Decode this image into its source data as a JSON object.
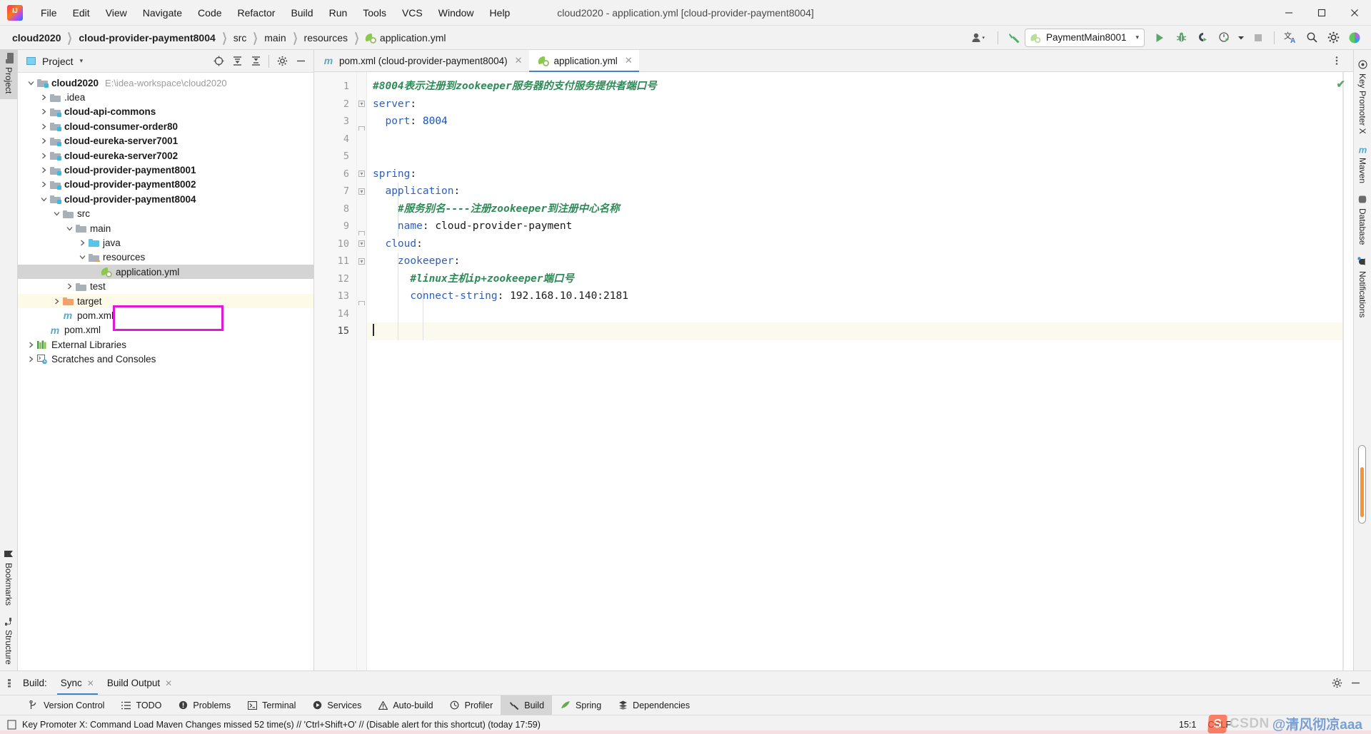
{
  "window": {
    "title": "cloud2020 - application.yml [cloud-provider-payment8004]",
    "logo_label": "IJ",
    "minimize": "─",
    "maximize": "❐",
    "close": "✕"
  },
  "menubar": [
    {
      "label": "File"
    },
    {
      "label": "Edit"
    },
    {
      "label": "View"
    },
    {
      "label": "Navigate"
    },
    {
      "label": "Code"
    },
    {
      "label": "Refactor"
    },
    {
      "label": "Build"
    },
    {
      "label": "Run"
    },
    {
      "label": "Tools"
    },
    {
      "label": "VCS"
    },
    {
      "label": "Window"
    },
    {
      "label": "Help"
    }
  ],
  "breadcrumbs": [
    {
      "label": "cloud2020",
      "bold": true
    },
    {
      "label": "cloud-provider-payment8004",
      "bold": true
    },
    {
      "label": "src",
      "bold": false
    },
    {
      "label": "main",
      "bold": false
    },
    {
      "label": "resources",
      "bold": false
    },
    {
      "label": "application.yml",
      "bold": false,
      "icon": "spring-yml-icon"
    }
  ],
  "navbar_right": {
    "account_icon": "user-avatar-icon",
    "hammer_icon": "build-hammer-icon",
    "run_config": {
      "name": "PaymentMain8001",
      "icon": "spring-boot-icon",
      "caret": "▾"
    },
    "run_icon": "run-icon",
    "debug_icon": "debug-bug-icon",
    "coverage_icon": "run-with-coverage-icon",
    "profiler_icon": "profile-icon",
    "stop_icon": "stop-icon",
    "translate_icon": "translate-icon",
    "search_icon": "search-everywhere-icon",
    "settings_icon": "gear-icon",
    "updates_icon": "ide-updates-icon"
  },
  "left_strip": [
    {
      "label": "Project",
      "icon": "project-folder-icon",
      "active": true
    },
    {
      "label": "Bookmarks",
      "icon": "bookmark-icon",
      "active": false
    },
    {
      "label": "Structure",
      "icon": "structure-icon",
      "active": false
    }
  ],
  "right_strip": [
    {
      "label": "Key Promoter X",
      "icon": "key-promoter-icon"
    },
    {
      "label": "Maven",
      "icon": "maven-m-icon"
    },
    {
      "label": "Database",
      "icon": "database-icon"
    },
    {
      "label": "Notifications",
      "icon": "notifications-bell-icon"
    }
  ],
  "project_panel": {
    "title": "Project",
    "caret": "▾",
    "actions": [
      {
        "name": "select-opened-file-icon",
        "glyph": "⊕"
      },
      {
        "name": "expand-all-icon",
        "glyph": "⤓"
      },
      {
        "name": "collapse-all-icon",
        "glyph": "⤑"
      },
      {
        "name": "gear-icon",
        "glyph": "⚙"
      },
      {
        "name": "hide-icon",
        "glyph": "─"
      }
    ],
    "tree": [
      {
        "label": "cloud2020",
        "path": "E:\\idea-workspace\\cloud2020",
        "indent": 0,
        "arrow": "down",
        "icon": "module-folder-icon",
        "bold": true
      },
      {
        "label": ".idea",
        "indent": 1,
        "arrow": "right",
        "icon": "folder-icon",
        "bold": false
      },
      {
        "label": "cloud-api-commons",
        "indent": 1,
        "arrow": "right",
        "icon": "module-folder-icon",
        "bold": true
      },
      {
        "label": "cloud-consumer-order80",
        "indent": 1,
        "arrow": "right",
        "icon": "module-folder-icon",
        "bold": true
      },
      {
        "label": "cloud-eureka-server7001",
        "indent": 1,
        "arrow": "right",
        "icon": "module-folder-icon",
        "bold": true
      },
      {
        "label": "cloud-eureka-server7002",
        "indent": 1,
        "arrow": "right",
        "icon": "module-folder-icon",
        "bold": true
      },
      {
        "label": "cloud-provider-payment8001",
        "indent": 1,
        "arrow": "right",
        "icon": "module-folder-icon",
        "bold": true
      },
      {
        "label": "cloud-provider-payment8002",
        "indent": 1,
        "arrow": "right",
        "icon": "module-folder-icon",
        "bold": true
      },
      {
        "label": "cloud-provider-payment8004",
        "indent": 1,
        "arrow": "down",
        "icon": "module-folder-icon",
        "bold": true
      },
      {
        "label": "src",
        "indent": 2,
        "arrow": "down",
        "icon": "folder-icon",
        "bold": false
      },
      {
        "label": "main",
        "indent": 3,
        "arrow": "down",
        "icon": "folder-icon",
        "bold": false
      },
      {
        "label": "java",
        "indent": 4,
        "arrow": "right",
        "icon": "source-folder-icon",
        "bold": false
      },
      {
        "label": "resources",
        "indent": 4,
        "arrow": "down",
        "icon": "resources-folder-icon",
        "bold": false
      },
      {
        "label": "application.yml",
        "indent": 5,
        "arrow": "none",
        "icon": "spring-yml-icon",
        "bold": false,
        "selected": true,
        "highlighted": true
      },
      {
        "label": "test",
        "indent": 3,
        "arrow": "right",
        "icon": "folder-icon",
        "bold": false
      },
      {
        "label": "target",
        "indent": 2,
        "arrow": "right",
        "icon": "target-folder-icon",
        "bold": false,
        "modified": true
      },
      {
        "label": "pom.xml",
        "indent": 2,
        "arrow": "none",
        "icon": "maven-m-icon",
        "bold": false
      },
      {
        "label": "pom.xml",
        "indent": 1,
        "arrow": "none",
        "icon": "maven-m-icon",
        "bold": false
      },
      {
        "label": "External Libraries",
        "indent": 0,
        "arrow": "right",
        "icon": "external-libraries-icon",
        "bold": false
      },
      {
        "label": "Scratches and Consoles",
        "indent": 0,
        "arrow": "right",
        "icon": "scratches-icon",
        "bold": false
      }
    ]
  },
  "editor": {
    "tabs": [
      {
        "label": "pom.xml (cloud-provider-payment8004)",
        "icon": "maven-m-icon",
        "active": false,
        "close": "✕"
      },
      {
        "label": "application.yml",
        "icon": "spring-yml-icon",
        "active": true,
        "close": "✕"
      }
    ],
    "inspection_status": "✔",
    "lines": [
      {
        "n": 1,
        "segs": [
          {
            "t": "#8004表示注册到zookeeper服务器的支付服务提供者端口号",
            "c": "cmt"
          }
        ],
        "indent": 0,
        "fold": "none"
      },
      {
        "n": 2,
        "segs": [
          {
            "t": "server",
            "c": "kw"
          },
          {
            "t": ":",
            "c": "val"
          }
        ],
        "indent": 0,
        "fold": "open"
      },
      {
        "n": 3,
        "segs": [
          {
            "t": "  port",
            "c": "kw"
          },
          {
            "t": ": ",
            "c": "val"
          },
          {
            "t": "8004",
            "c": "num"
          }
        ],
        "indent": 1,
        "fold": "end"
      },
      {
        "n": 4,
        "segs": [],
        "indent": 0,
        "fold": "none"
      },
      {
        "n": 5,
        "segs": [],
        "indent": 0,
        "fold": "none"
      },
      {
        "n": 6,
        "segs": [
          {
            "t": "spring",
            "c": "kw"
          },
          {
            "t": ":",
            "c": "val"
          }
        ],
        "indent": 0,
        "fold": "open"
      },
      {
        "n": 7,
        "segs": [
          {
            "t": "  application",
            "c": "kw"
          },
          {
            "t": ":",
            "c": "val"
          }
        ],
        "indent": 1,
        "fold": "open"
      },
      {
        "n": 8,
        "segs": [
          {
            "t": "    #服务别名----注册zookeeper到注册中心名称",
            "c": "cmt"
          }
        ],
        "indent": 2,
        "fold": "none"
      },
      {
        "n": 9,
        "segs": [
          {
            "t": "    name",
            "c": "kw"
          },
          {
            "t": ": ",
            "c": "val"
          },
          {
            "t": "cloud-provider-payment",
            "c": "val"
          }
        ],
        "indent": 2,
        "fold": "end"
      },
      {
        "n": 10,
        "segs": [
          {
            "t": "  cloud",
            "c": "kw"
          },
          {
            "t": ":",
            "c": "val"
          }
        ],
        "indent": 1,
        "fold": "open"
      },
      {
        "n": 11,
        "segs": [
          {
            "t": "    zookeeper",
            "c": "kw"
          },
          {
            "t": ":",
            "c": "val"
          }
        ],
        "indent": 2,
        "fold": "open"
      },
      {
        "n": 12,
        "segs": [
          {
            "t": "      #linux主机ip+zookeeper端口号",
            "c": "cmt"
          }
        ],
        "indent": 3,
        "fold": "none"
      },
      {
        "n": 13,
        "segs": [
          {
            "t": "      connect-string",
            "c": "kw"
          },
          {
            "t": ": ",
            "c": "val"
          },
          {
            "t": "192.168.10.140:2181",
            "c": "val"
          }
        ],
        "indent": 3,
        "fold": "end"
      },
      {
        "n": 14,
        "segs": [],
        "indent": 0,
        "fold": "none"
      },
      {
        "n": 15,
        "segs": [],
        "indent": 0,
        "fold": "none",
        "current": true
      }
    ]
  },
  "build_panel": {
    "icon": "build-tool-window-icon",
    "label": "Build:",
    "tabs": [
      {
        "label": "Sync",
        "active": true,
        "close": "✕"
      },
      {
        "label": "Build Output",
        "active": false,
        "close": "✕"
      }
    ],
    "actions": [
      {
        "name": "gear-icon",
        "glyph": "⚙"
      },
      {
        "name": "hide-icon",
        "glyph": "─"
      }
    ]
  },
  "bottom_tools": [
    {
      "label": "Version Control",
      "icon": "branch-icon",
      "active": false
    },
    {
      "label": "TODO",
      "icon": "todo-list-icon",
      "active": false
    },
    {
      "label": "Problems",
      "icon": "problems-icon",
      "active": false
    },
    {
      "label": "Terminal",
      "icon": "terminal-icon",
      "active": false
    },
    {
      "label": "Services",
      "icon": "services-icon",
      "active": false
    },
    {
      "label": "Auto-build",
      "icon": "auto-build-warning-icon",
      "active": false
    },
    {
      "label": "Profiler",
      "icon": "profiler-icon",
      "active": false
    },
    {
      "label": "Build",
      "icon": "build-hammer-icon",
      "active": true
    },
    {
      "label": "Spring",
      "icon": "spring-leaf-icon",
      "active": false
    },
    {
      "label": "Dependencies",
      "icon": "dependencies-icon",
      "active": false
    }
  ],
  "statusbar": {
    "icon": "key-promoter-notification-icon",
    "message": "Key Promoter X: Command Load Maven Changes missed 52 time(s) // 'Ctrl+Shift+O' // (Disable alert for this shortcut) (today 17:59)",
    "caret_position": "15:1",
    "line_separator": "CRLF"
  },
  "watermark": {
    "logo": "S",
    "brand": "CSDN",
    "author": "@清风彻凉aaa"
  },
  "colors": {
    "accent_blue": "#4083c9",
    "keyword_blue": "#2f5fbd",
    "comment_green": "#2e8b57",
    "highlight_pink": "#e018d8",
    "selection_gray": "#d4d4d4",
    "modified_yellow": "#fdfae7",
    "status_green": "#59a869"
  }
}
